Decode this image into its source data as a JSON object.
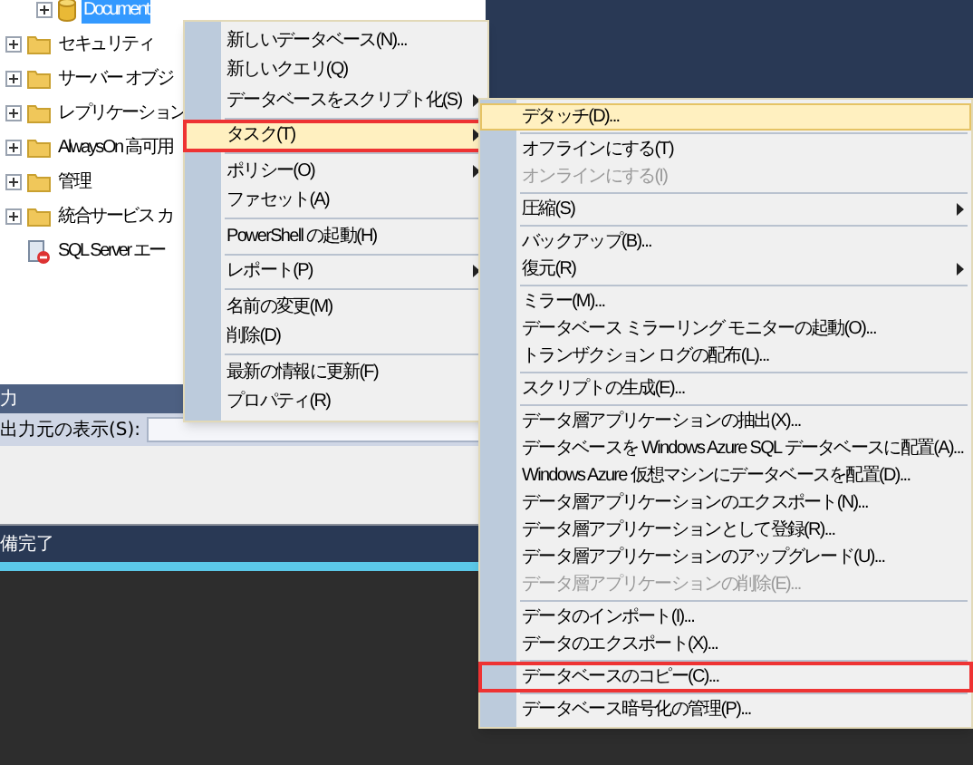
{
  "tree": [
    {
      "kind": "database",
      "label": "Document",
      "selected": true
    },
    {
      "kind": "folder",
      "label": "セキュリティ",
      "selected": false
    },
    {
      "kind": "folder",
      "label": "サーバー オブジ",
      "selected": false
    },
    {
      "kind": "folder",
      "label": "レプリケーション",
      "selected": false
    },
    {
      "kind": "folder",
      "label": "AlwaysOn 高可用",
      "selected": false
    },
    {
      "kind": "folder",
      "label": "管理",
      "selected": false
    },
    {
      "kind": "folder",
      "label": "統合サービス カ",
      "selected": false
    },
    {
      "kind": "agent",
      "label": "SQL Server エー",
      "selected": false
    }
  ],
  "output": {
    "title": "力",
    "source_label": "出力元の表示(S):"
  },
  "status_bar": "備完了",
  "context_menu": [
    {
      "kind": "item",
      "label": "新しいデータベース(N)...",
      "submenu": false,
      "highlighted": false,
      "outlined": false,
      "disabled": false
    },
    {
      "kind": "item",
      "label": "新しいクエリ(Q)",
      "submenu": false,
      "highlighted": false,
      "outlined": false,
      "disabled": false
    },
    {
      "kind": "item",
      "label": "データベースをスクリプト化(S)",
      "submenu": true,
      "highlighted": false,
      "outlined": false,
      "disabled": false
    },
    {
      "kind": "separator"
    },
    {
      "kind": "item",
      "label": "タスク(T)",
      "submenu": true,
      "highlighted": true,
      "outlined": true,
      "disabled": false
    },
    {
      "kind": "separator"
    },
    {
      "kind": "item",
      "label": "ポリシー(O)",
      "submenu": true,
      "highlighted": false,
      "outlined": false,
      "disabled": false
    },
    {
      "kind": "item",
      "label": "ファセット(A)",
      "submenu": false,
      "highlighted": false,
      "outlined": false,
      "disabled": false
    },
    {
      "kind": "separator"
    },
    {
      "kind": "item",
      "label": "PowerShell の起動(H)",
      "submenu": false,
      "highlighted": false,
      "outlined": false,
      "disabled": false
    },
    {
      "kind": "separator"
    },
    {
      "kind": "item",
      "label": "レポート(P)",
      "submenu": true,
      "highlighted": false,
      "outlined": false,
      "disabled": false
    },
    {
      "kind": "separator"
    },
    {
      "kind": "item",
      "label": "名前の変更(M)",
      "submenu": false,
      "highlighted": false,
      "outlined": false,
      "disabled": false
    },
    {
      "kind": "item",
      "label": "削除(D)",
      "submenu": false,
      "highlighted": false,
      "outlined": false,
      "disabled": false
    },
    {
      "kind": "separator"
    },
    {
      "kind": "item",
      "label": "最新の情報に更新(F)",
      "submenu": false,
      "highlighted": false,
      "outlined": false,
      "disabled": false
    },
    {
      "kind": "item",
      "label": "プロパティ(R)",
      "submenu": false,
      "highlighted": false,
      "outlined": false,
      "disabled": false
    }
  ],
  "task_submenu": [
    {
      "kind": "item",
      "label": "デタッチ(D)...",
      "submenu": false,
      "highlighted": true,
      "outlined": false,
      "disabled": false
    },
    {
      "kind": "separator"
    },
    {
      "kind": "item",
      "label": "オフラインにする(T)",
      "submenu": false,
      "highlighted": false,
      "outlined": false,
      "disabled": false
    },
    {
      "kind": "item",
      "label": "オンラインにする(I)",
      "submenu": false,
      "highlighted": false,
      "outlined": false,
      "disabled": true
    },
    {
      "kind": "separator"
    },
    {
      "kind": "item",
      "label": "圧縮(S)",
      "submenu": true,
      "highlighted": false,
      "outlined": false,
      "disabled": false
    },
    {
      "kind": "separator"
    },
    {
      "kind": "item",
      "label": "バックアップ(B)...",
      "submenu": false,
      "highlighted": false,
      "outlined": false,
      "disabled": false
    },
    {
      "kind": "item",
      "label": "復元(R)",
      "submenu": true,
      "highlighted": false,
      "outlined": false,
      "disabled": false
    },
    {
      "kind": "separator"
    },
    {
      "kind": "item",
      "label": "ミラー(M)...",
      "submenu": false,
      "highlighted": false,
      "outlined": false,
      "disabled": false
    },
    {
      "kind": "item",
      "label": "データベース ミラーリング モニターの起動(O)...",
      "submenu": false,
      "highlighted": false,
      "outlined": false,
      "disabled": false
    },
    {
      "kind": "item",
      "label": "トランザクション ログの配布(L)...",
      "submenu": false,
      "highlighted": false,
      "outlined": false,
      "disabled": false
    },
    {
      "kind": "separator"
    },
    {
      "kind": "item",
      "label": "スクリプトの生成(E)...",
      "submenu": false,
      "highlighted": false,
      "outlined": false,
      "disabled": false
    },
    {
      "kind": "separator"
    },
    {
      "kind": "item",
      "label": "データ層アプリケーションの抽出(X)...",
      "submenu": false,
      "highlighted": false,
      "outlined": false,
      "disabled": false
    },
    {
      "kind": "item",
      "label": "データベースを Windows Azure SQL データベースに配置(A)...",
      "submenu": false,
      "highlighted": false,
      "outlined": false,
      "disabled": false
    },
    {
      "kind": "item",
      "label": "Windows Azure 仮想マシンにデータベースを配置(D)...",
      "submenu": false,
      "highlighted": false,
      "outlined": false,
      "disabled": false
    },
    {
      "kind": "item",
      "label": "データ層アプリケーションのエクスポート(N)...",
      "submenu": false,
      "highlighted": false,
      "outlined": false,
      "disabled": false
    },
    {
      "kind": "item",
      "label": "データ層アプリケーションとして登録(R)...",
      "submenu": false,
      "highlighted": false,
      "outlined": false,
      "disabled": false
    },
    {
      "kind": "item",
      "label": "データ層アプリケーションのアップグレード(U)...",
      "submenu": false,
      "highlighted": false,
      "outlined": false,
      "disabled": false
    },
    {
      "kind": "item",
      "label": "データ層アプリケーションの削除(E)...",
      "submenu": false,
      "highlighted": false,
      "outlined": false,
      "disabled": true
    },
    {
      "kind": "separator"
    },
    {
      "kind": "item",
      "label": "データのインポート(I)...",
      "submenu": false,
      "highlighted": false,
      "outlined": false,
      "disabled": false
    },
    {
      "kind": "item",
      "label": "データのエクスポート(X)...",
      "submenu": false,
      "highlighted": false,
      "outlined": false,
      "disabled": false
    },
    {
      "kind": "separator"
    },
    {
      "kind": "item",
      "label": "データベースのコピー(C)...",
      "submenu": false,
      "highlighted": false,
      "outlined": true,
      "disabled": false
    },
    {
      "kind": "separator"
    },
    {
      "kind": "item",
      "label": "データベース暗号化の管理(P)...",
      "submenu": false,
      "highlighted": false,
      "outlined": false,
      "disabled": false
    }
  ]
}
